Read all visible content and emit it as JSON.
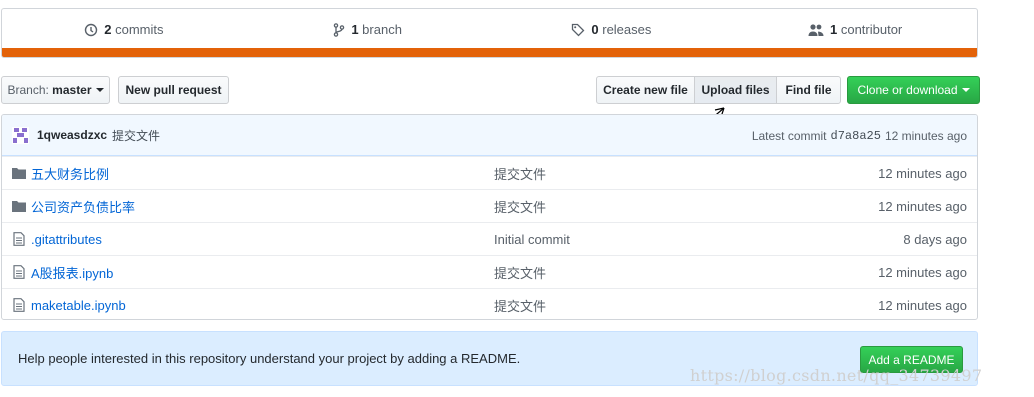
{
  "stats": {
    "commits_count": "2",
    "commits_label": "commits",
    "branch_count": "1",
    "branch_label": "branch",
    "releases_count": "0",
    "releases_label": "releases",
    "contributors_count": "1",
    "contributors_label": "contributor",
    "language_color": "#e36209"
  },
  "toolbar": {
    "branch_prefix": "Branch:",
    "branch_name": "master",
    "new_pull_request": "New pull request",
    "create_new_file": "Create new file",
    "upload_files": "Upload files",
    "find_file": "Find file",
    "clone_or_download": "Clone or download"
  },
  "commit": {
    "author": "1qweasdzxc",
    "message": "提交文件",
    "latest_label": "Latest commit",
    "sha": "d7a8a25",
    "age": "12 minutes ago"
  },
  "files": [
    {
      "type": "folder",
      "name": "五大财务比例",
      "message": "提交文件",
      "age": "12 minutes ago"
    },
    {
      "type": "folder",
      "name": "公司资产负债比率",
      "message": "提交文件",
      "age": "12 minutes ago"
    },
    {
      "type": "file",
      "name": ".gitattributes",
      "message": "Initial commit",
      "age": "8 days ago"
    },
    {
      "type": "file",
      "name": "A股报表.ipynb",
      "message": "提交文件",
      "age": "12 minutes ago"
    },
    {
      "type": "file",
      "name": "maketable.ipynb",
      "message": "提交文件",
      "age": "12 minutes ago"
    }
  ],
  "readme_banner": {
    "text": "Help people interested in this repository understand your project by adding a README.",
    "button": "Add a README"
  },
  "watermark": "https://blog.csdn.net/qq_34739497"
}
